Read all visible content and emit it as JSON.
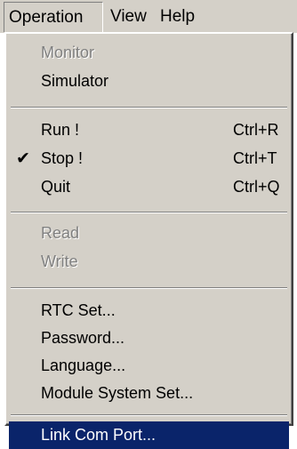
{
  "menubar": {
    "items": [
      {
        "label": "Operation"
      },
      {
        "label": "View"
      },
      {
        "label": "Help"
      }
    ]
  },
  "menu": {
    "monitor": {
      "label": "Monitor"
    },
    "simulator": {
      "label": "Simulator"
    },
    "run": {
      "label": "Run !",
      "shortcut": "Ctrl+R"
    },
    "stop": {
      "label": "Stop !",
      "shortcut": "Ctrl+T",
      "checked": true
    },
    "quit": {
      "label": "Quit",
      "shortcut": "Ctrl+Q"
    },
    "read": {
      "label": "Read"
    },
    "write": {
      "label": "Write"
    },
    "rtc_set": {
      "label": "RTC Set..."
    },
    "password": {
      "label": "Password..."
    },
    "language": {
      "label": "Language..."
    },
    "module_system_set": {
      "label": "Module System Set..."
    },
    "link_com_port": {
      "label": "Link Com Port..."
    }
  },
  "icons": {
    "check": "checkmark-icon"
  },
  "colors": {
    "menu_bg": "#d4d0c8",
    "highlight": "#0a246a",
    "disabled_text": "#808080"
  }
}
